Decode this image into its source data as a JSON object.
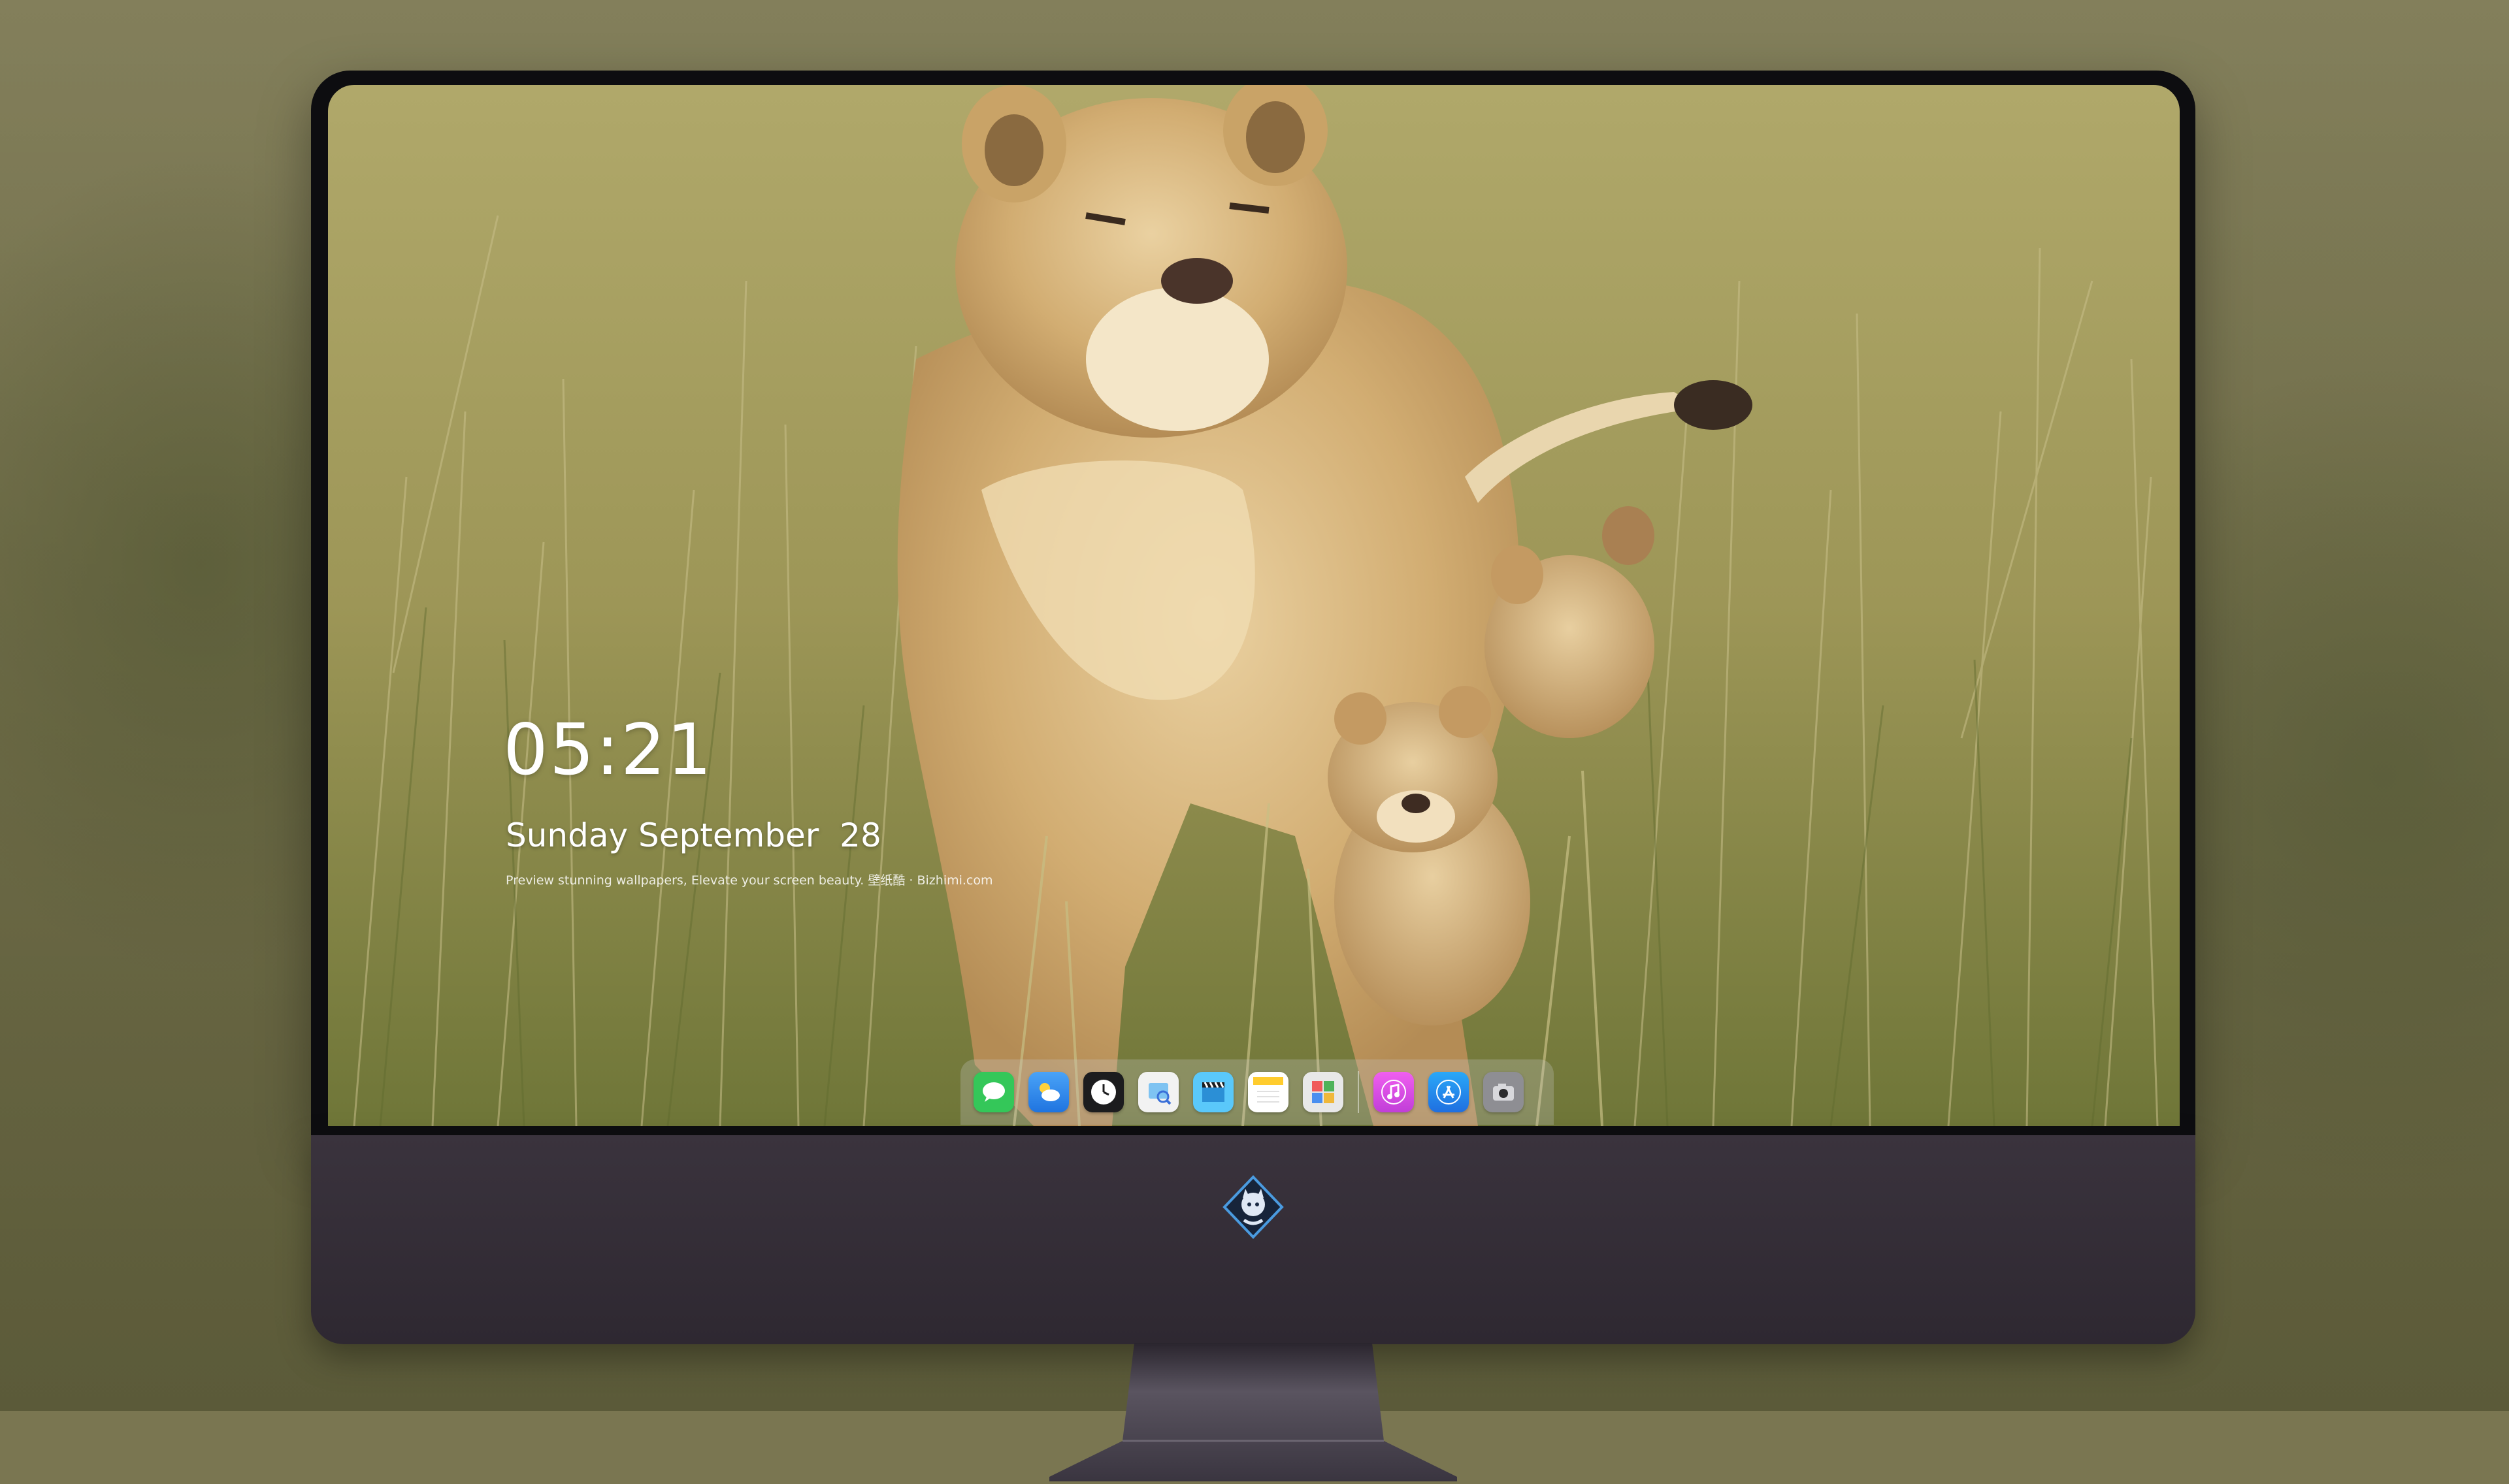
{
  "lockscreen": {
    "time": "05:21",
    "date": "Sunday September  28",
    "tagline": "Preview stunning wallpapers, Elevate your screen beauty. 壁纸酷 · Bizhimi.com"
  },
  "dock": {
    "apps": [
      {
        "icon": "messages-icon",
        "color": "#34c759"
      },
      {
        "icon": "weather-icon",
        "color": "#2e8bf0"
      },
      {
        "icon": "clock-icon",
        "color": "#1c1c1e"
      },
      {
        "icon": "preview-icon",
        "color": "#f2f2f2"
      },
      {
        "icon": "clips-icon",
        "color": "#5ac8fa"
      },
      {
        "icon": "notes-icon",
        "color": "#ffd84a"
      },
      {
        "icon": "photo-booth-icon",
        "color": "#e8e8e8"
      },
      {
        "icon": "itunes-icon",
        "color": "#e94ad8"
      },
      {
        "icon": "app-store-icon",
        "color": "#1f8ff0"
      },
      {
        "icon": "camera-icon",
        "color": "#8e8e93"
      }
    ]
  },
  "colors": {
    "bezel": "#0d0d10",
    "chin": "#3a333d",
    "stand": "#4a4552",
    "grass": "#a39a5c"
  }
}
